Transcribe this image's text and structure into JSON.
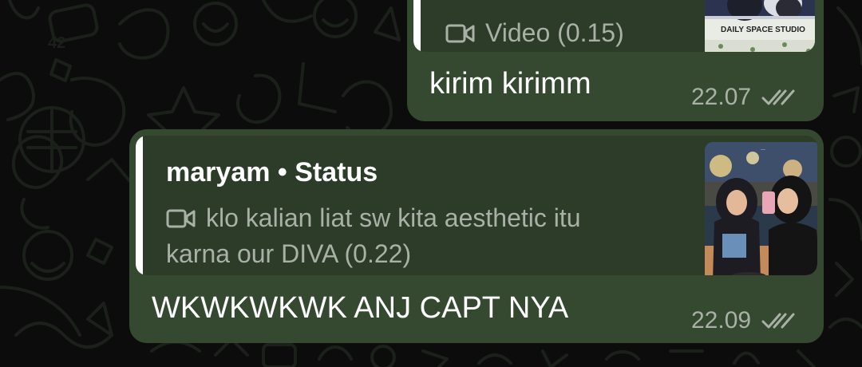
{
  "messages": [
    {
      "quote": {
        "author": "",
        "media_icon": "video-camera-icon",
        "lines": [
          "Video (0.15)"
        ],
        "thumbnail_caption": "DAILY SPACE STUDIO"
      },
      "text": "kirim kirimm",
      "time": "22.07",
      "status_icon": "double-check-icon"
    },
    {
      "quote": {
        "author": "maryam • Status",
        "media_icon": "video-camera-icon",
        "lines": [
          "klo kalian liat sw kita aesthetic itu",
          "karna our DIVA (0.22)"
        ],
        "thumbnail_caption": ""
      },
      "text": "WKWKWKWK ANJ CAPT NYA",
      "time": "22.09",
      "status_icon": "double-check-icon"
    }
  ],
  "colors": {
    "background": "#0b0c0b",
    "bubble": "#354931",
    "quote_box": "#2c3c29",
    "quote_bar": "#ffffff",
    "muted_text": "#a9b1a6",
    "text": "#ffffff"
  }
}
